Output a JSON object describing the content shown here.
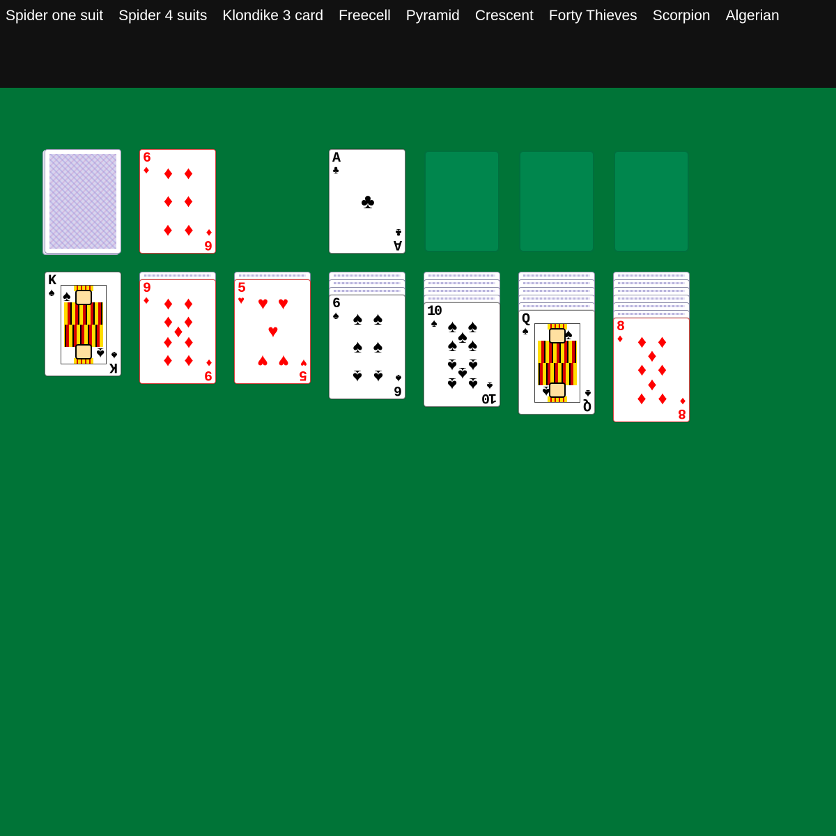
{
  "nav": {
    "items": [
      "Spider one suit",
      "Spider 4 suits",
      "Klondike 3 card",
      "Freecell",
      "Pyramid",
      "Crescent",
      "Forty Thieves",
      "Scorpion",
      "Algerian"
    ]
  },
  "colors": {
    "felt": "#007437",
    "topbar": "#111111",
    "empty_slot": "#00864d",
    "red_suit": "#ff0000",
    "black_suit": "#000000"
  },
  "stock": {
    "face_down": true
  },
  "waste": {
    "rank": "6",
    "suit": "diamond",
    "suit_glyph": "♦"
  },
  "foundations": [
    {
      "rank": "A",
      "suit": "club",
      "suit_glyph": "♣"
    },
    {
      "empty": true
    },
    {
      "empty": true
    },
    {
      "empty": true
    }
  ],
  "tableau": [
    {
      "hidden": 0,
      "top": {
        "rank": "K",
        "suit": "spade",
        "suit_glyph": "♠"
      }
    },
    {
      "hidden": 1,
      "top": {
        "rank": "9",
        "suit": "diamond",
        "suit_glyph": "♦"
      }
    },
    {
      "hidden": 1,
      "top": {
        "rank": "5",
        "suit": "heart",
        "suit_glyph": "♥"
      }
    },
    {
      "hidden": 3,
      "top": {
        "rank": "6",
        "suit": "spade",
        "suit_glyph": "♠"
      }
    },
    {
      "hidden": 4,
      "top": {
        "rank": "10",
        "suit": "spade",
        "suit_glyph": "♠"
      }
    },
    {
      "hidden": 5,
      "top": {
        "rank": "Q",
        "suit": "spade",
        "suit_glyph": "♠"
      }
    },
    {
      "hidden": 6,
      "top": {
        "rank": "8",
        "suit": "diamond",
        "suit_glyph": "♦"
      }
    }
  ]
}
